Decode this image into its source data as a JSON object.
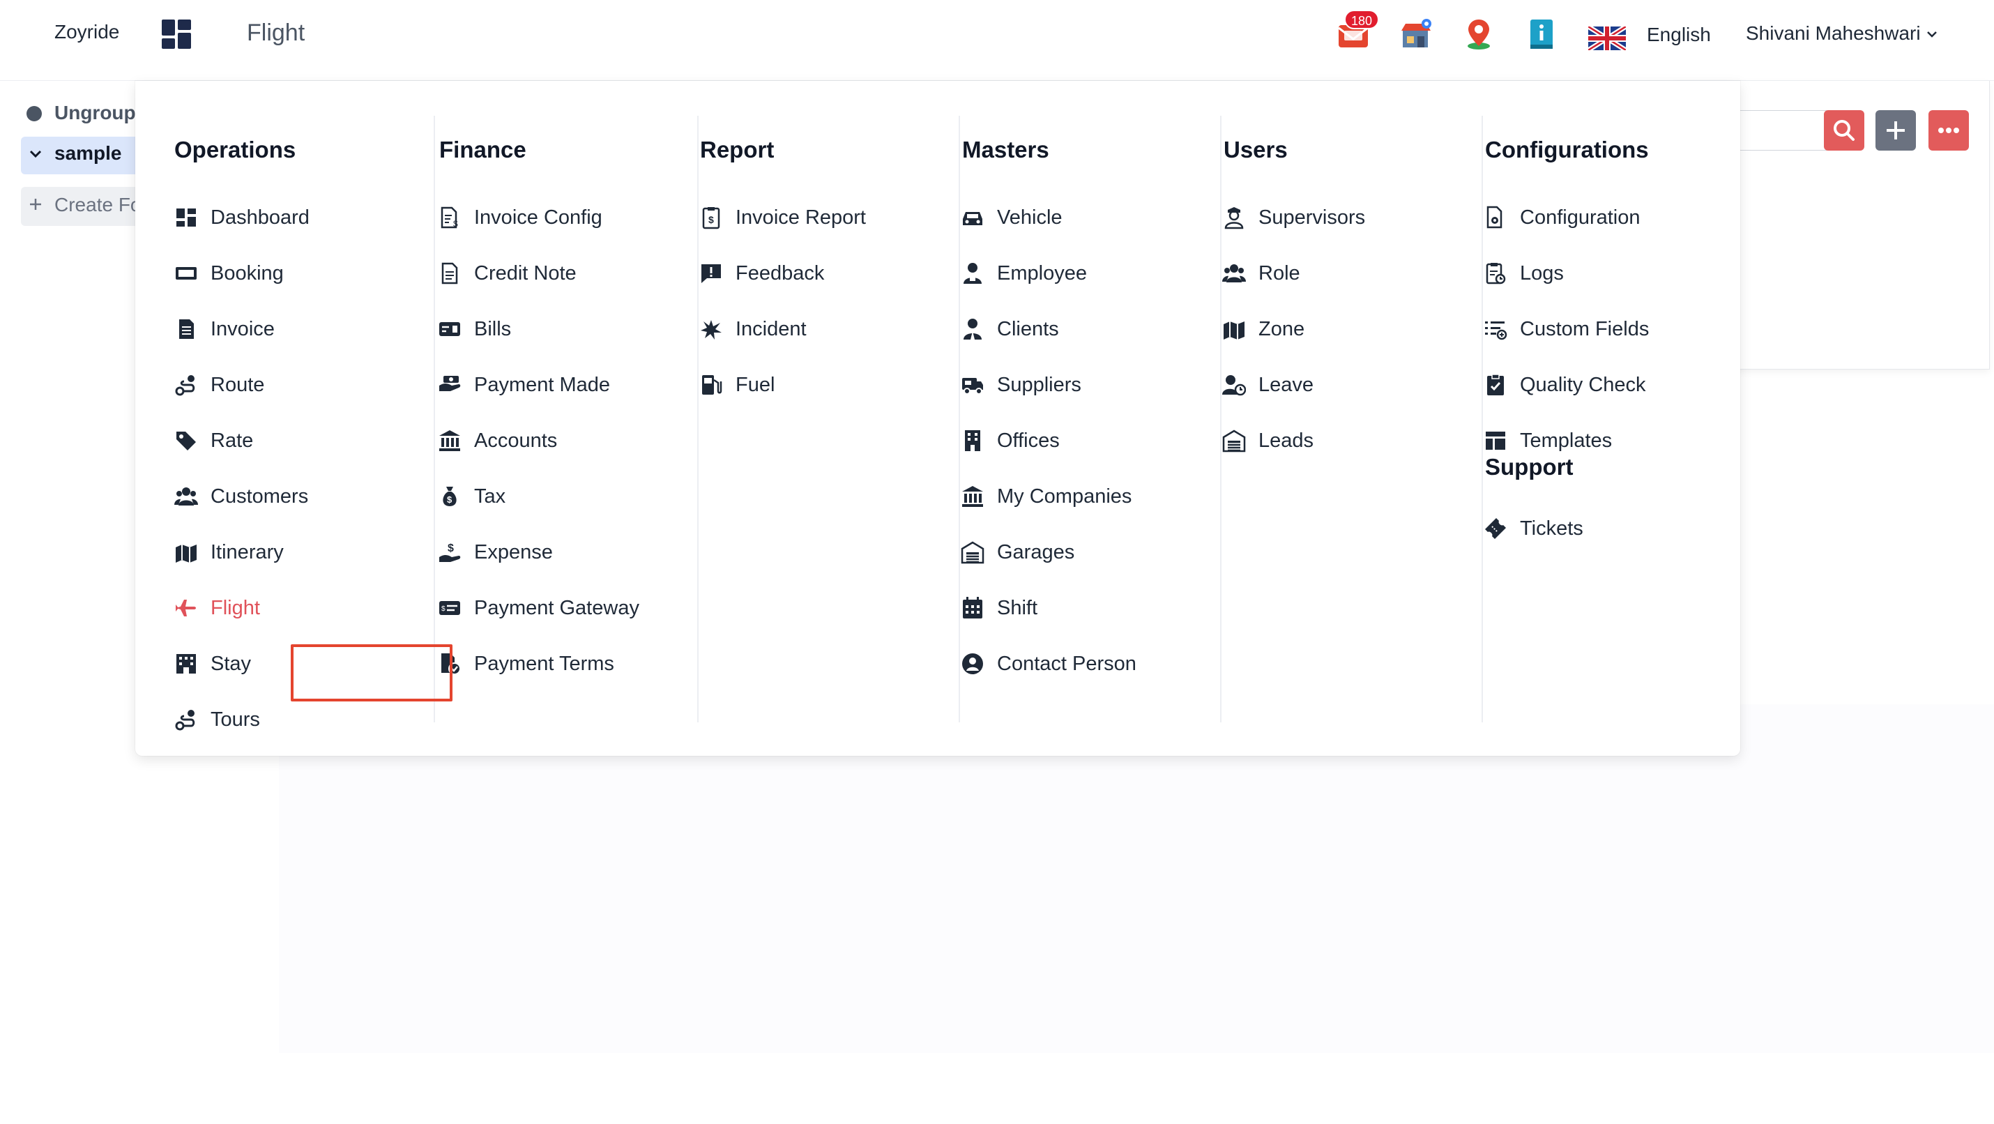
{
  "topbar": {
    "brand": "Zoyride",
    "page_title": "Flight",
    "notification_count": "180",
    "language": "English",
    "user_name": "Shivani Maheshwari",
    "icons": [
      "notifications-icon",
      "marketplace-icon",
      "map-pin-icon",
      "info-book-icon",
      "uk-flag-icon"
    ]
  },
  "sidebar": {
    "ungrouped": "Ungroup",
    "group": "sample",
    "create": "Create Fo"
  },
  "menu": {
    "active_item": "Flight",
    "accent_color": "#e0525a",
    "operations": {
      "title": "Operations",
      "items": [
        {
          "label": "Dashboard",
          "icon": "dashboard-icon"
        },
        {
          "label": "Booking",
          "icon": "booking-icon"
        },
        {
          "label": "Invoice",
          "icon": "invoice-icon"
        },
        {
          "label": "Route",
          "icon": "route-icon"
        },
        {
          "label": "Rate",
          "icon": "tag-icon"
        },
        {
          "label": "Customers",
          "icon": "users-icon"
        },
        {
          "label": "Itinerary",
          "icon": "map-icon"
        },
        {
          "label": "Flight",
          "icon": "plane-icon"
        },
        {
          "label": "Stay",
          "icon": "hotel-icon"
        },
        {
          "label": "Tours",
          "icon": "route-icon"
        }
      ]
    },
    "finance": {
      "title": "Finance",
      "items": [
        {
          "label": "Invoice Config",
          "icon": "invoice-config-icon"
        },
        {
          "label": "Credit Note",
          "icon": "document-icon"
        },
        {
          "label": "Bills",
          "icon": "bills-icon"
        },
        {
          "label": "Payment Made",
          "icon": "hand-money-icon"
        },
        {
          "label": "Accounts",
          "icon": "bank-icon"
        },
        {
          "label": "Tax",
          "icon": "money-bag-icon"
        },
        {
          "label": "Expense",
          "icon": "expense-icon"
        },
        {
          "label": "Payment Gateway",
          "icon": "card-icon"
        },
        {
          "label": "Payment Terms",
          "icon": "file-check-icon"
        }
      ]
    },
    "report": {
      "title": "Report",
      "items": [
        {
          "label": "Invoice Report",
          "icon": "report-icon"
        },
        {
          "label": "Feedback",
          "icon": "feedback-icon"
        },
        {
          "label": "Incident",
          "icon": "incident-icon"
        },
        {
          "label": "Fuel",
          "icon": "fuel-icon"
        }
      ]
    },
    "masters": {
      "title": "Masters",
      "items": [
        {
          "label": "Vehicle",
          "icon": "car-icon"
        },
        {
          "label": "Employee",
          "icon": "employee-icon"
        },
        {
          "label": "Clients",
          "icon": "client-icon"
        },
        {
          "label": "Suppliers",
          "icon": "truck-icon"
        },
        {
          "label": "Offices",
          "icon": "building-icon"
        },
        {
          "label": "My Companies",
          "icon": "bank-icon"
        },
        {
          "label": "Garages",
          "icon": "garage-icon"
        },
        {
          "label": "Shift",
          "icon": "calendar-icon"
        },
        {
          "label": "Contact Person",
          "icon": "user-circle-icon"
        }
      ]
    },
    "users": {
      "title": "Users",
      "items": [
        {
          "label": "Supervisors",
          "icon": "supervisor-icon"
        },
        {
          "label": "Role",
          "icon": "users-icon"
        },
        {
          "label": "Zone",
          "icon": "map-icon"
        },
        {
          "label": "Leave",
          "icon": "user-clock-icon"
        },
        {
          "label": "Leads",
          "icon": "garage-icon"
        }
      ]
    },
    "configurations": {
      "title": "Configurations",
      "items": [
        {
          "label": "Configuration",
          "icon": "file-gear-icon"
        },
        {
          "label": "Logs",
          "icon": "logs-icon"
        },
        {
          "label": "Custom Fields",
          "icon": "list-add-icon"
        },
        {
          "label": "Quality Check",
          "icon": "clipboard-check-icon"
        },
        {
          "label": "Templates",
          "icon": "template-icon"
        }
      ]
    },
    "support": {
      "title": "Support",
      "items": [
        {
          "label": "Tickets",
          "icon": "ticket-icon"
        }
      ]
    }
  }
}
